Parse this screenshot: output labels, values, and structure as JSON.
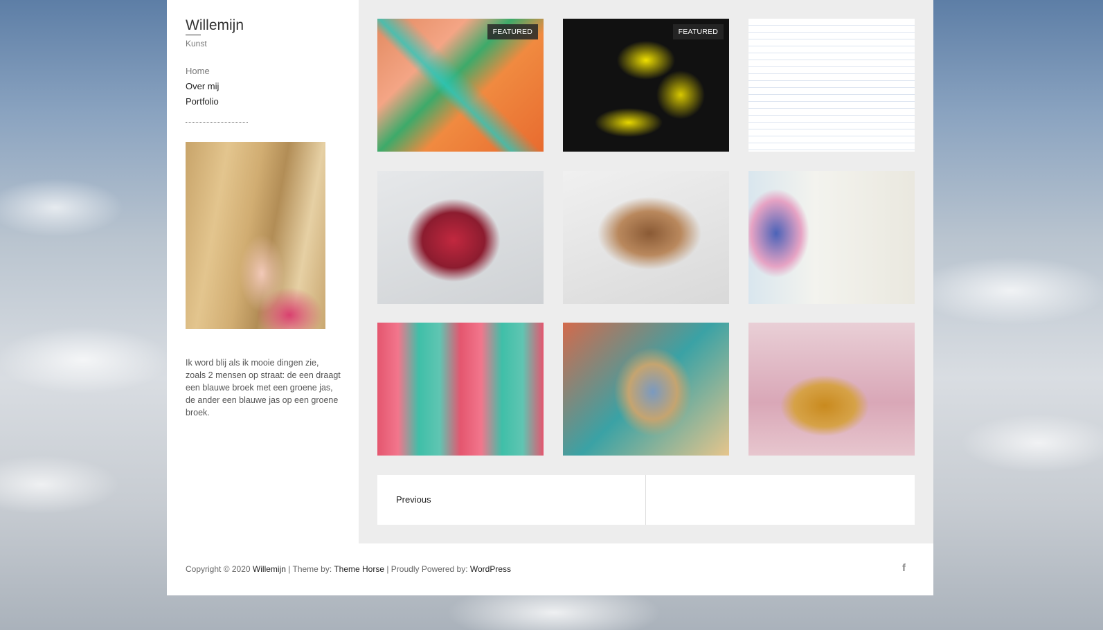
{
  "site": {
    "title": "Willemijn",
    "tagline": "Kunst"
  },
  "nav": {
    "items": [
      {
        "label": "Home"
      },
      {
        "label": "Over mij"
      },
      {
        "label": "Portfolio"
      }
    ]
  },
  "sidebar": {
    "bio": "Ik word blij als ik mooie dingen zie, zoals 2 mensen op straat: de een draagt een blauwe broek met een groene jas, de ander een blauwe jas op een groene broek."
  },
  "portfolio": {
    "featured_label": "FEATURED"
  },
  "pagination": {
    "previous": "Previous"
  },
  "footer": {
    "copyright_prefix": "Copyright © 2020",
    "site_link": "Willemijn",
    "theme_prefix": "| Theme by:",
    "theme_link": "Theme Horse",
    "powered_prefix": "| Proudly Powered by:",
    "powered_link": "WordPress",
    "social_icon": "facebook-icon"
  }
}
